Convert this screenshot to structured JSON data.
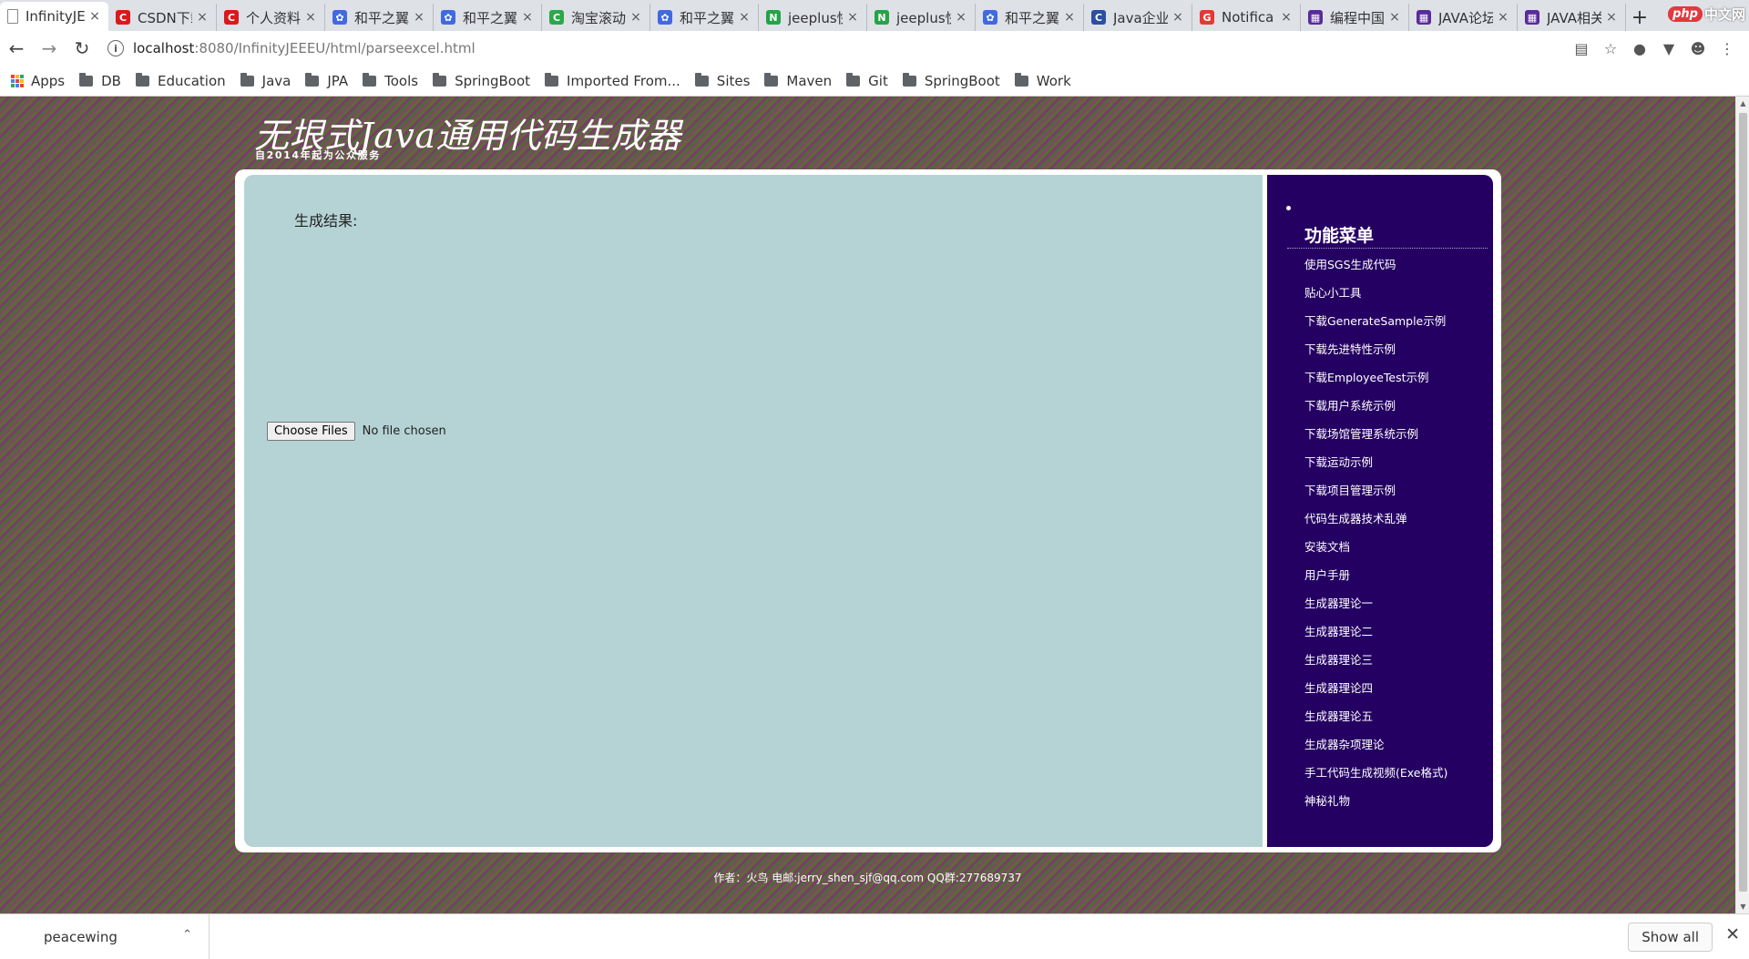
{
  "browser": {
    "tabs": [
      {
        "label": "InfinityJEEEU",
        "close": "×",
        "icon": "page-icon",
        "icon_color": "#888888",
        "active": true
      },
      {
        "label": "CSDN下载",
        "close": "×",
        "icon": "csdn-icon",
        "icon_color": "#d91a1a"
      },
      {
        "label": "个人资料",
        "close": "×",
        "icon": "csdn-icon",
        "icon_color": "#d91a1a"
      },
      {
        "label": "和平之翼",
        "close": "×",
        "icon": "paw-icon",
        "icon_color": "#4169e1"
      },
      {
        "label": "和平之翼",
        "close": "×",
        "icon": "paw-icon",
        "icon_color": "#4169e1"
      },
      {
        "label": "淘宝滚动",
        "close": "×",
        "icon": "swirl-icon",
        "icon_color": "#2aa84a"
      },
      {
        "label": "和平之翼",
        "close": "×",
        "icon": "paw-icon",
        "icon_color": "#4169e1"
      },
      {
        "label": "jeeplus快",
        "close": "×",
        "icon": "n-icon",
        "icon_color": "#22a447"
      },
      {
        "label": "jeeplus快",
        "close": "×",
        "icon": "n-icon",
        "icon_color": "#22a447"
      },
      {
        "label": "和平之翼",
        "close": "×",
        "icon": "paw-icon",
        "icon_color": "#4169e1"
      },
      {
        "label": "Java企业",
        "close": "×",
        "icon": "c-icon",
        "icon_color": "#2c4fa1"
      },
      {
        "label": "Notifica",
        "close": "×",
        "icon": "g-icon",
        "icon_color": "#e53935"
      },
      {
        "label": "编程中国",
        "close": "×",
        "icon": "grid-icon",
        "icon_color": "#5a2a9c"
      },
      {
        "label": "JAVA论坛",
        "close": "×",
        "icon": "grid-icon",
        "icon_color": "#5a2a9c"
      },
      {
        "label": "JAVA相关",
        "close": "×",
        "icon": "grid-icon",
        "icon_color": "#5a2a9c"
      }
    ],
    "new_tab": "+",
    "logo_badge": "php",
    "logo_text": "中文网",
    "url_host": "localhost",
    "url_path": ":8080/InfinityJEEEU/html/parseexcel.html",
    "bookmarks": [
      {
        "label": "Apps",
        "type": "apps"
      },
      {
        "label": "DB",
        "type": "folder"
      },
      {
        "label": "Education",
        "type": "folder"
      },
      {
        "label": "Java",
        "type": "folder"
      },
      {
        "label": "JPA",
        "type": "folder"
      },
      {
        "label": "Tools",
        "type": "folder"
      },
      {
        "label": "SpringBoot",
        "type": "folder"
      },
      {
        "label": "Imported From...",
        "type": "folder"
      },
      {
        "label": "Sites",
        "type": "folder"
      },
      {
        "label": "Maven",
        "type": "folder"
      },
      {
        "label": "Git",
        "type": "folder"
      },
      {
        "label": "SpringBoot",
        "type": "folder"
      },
      {
        "label": "Work",
        "type": "folder"
      }
    ]
  },
  "site": {
    "title": "无垠式Java通用代码生成器",
    "subtitle": "自2014年起为公众服务"
  },
  "main": {
    "result_label": "生成结果:",
    "file_button": "Choose Files",
    "file_status": "No file chosen"
  },
  "sidebar": {
    "heading": "功能菜单",
    "items": [
      "使用SGS生成代码",
      "贴心小工具",
      "下载GenerateSample示例",
      "下载先进特性示例",
      "下载EmployeeTest示例",
      "下载用户系统示例",
      "下载场馆管理系统示例",
      "下载运动示例",
      "下载项目管理示例",
      "代码生成器技术乱弹",
      "安装文档",
      "用户手册",
      "生成器理论一",
      "生成器理论二",
      "生成器理论三",
      "生成器理论四",
      "生成器理论五",
      "生成器杂项理论",
      "手工代码生成视频(Exe格式)",
      "神秘礼物"
    ]
  },
  "footer": {
    "text": "作者：火鸟 电邮:jerry_shen_sjf@qq.com QQ群:277689737"
  },
  "downloads": {
    "file": "peacewing",
    "show_all": "Show all"
  },
  "colors": {
    "content_bg": "#b5d3d4",
    "sidebar_bg": "#250063"
  }
}
